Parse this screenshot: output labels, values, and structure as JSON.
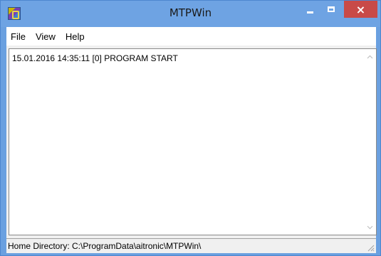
{
  "window": {
    "title": "MTPWin",
    "close_glyph": "×"
  },
  "menu": {
    "items": [
      {
        "label": "File"
      },
      {
        "label": "View"
      },
      {
        "label": "Help"
      }
    ]
  },
  "log": {
    "lines": [
      "15.01.2016 14:35:11 [0] PROGRAM START"
    ]
  },
  "status": {
    "text": "Home Directory: C:\\ProgramData\\aitronic\\MTPWin\\"
  },
  "icons": {
    "app": "app-icon",
    "minimize": "minimize-icon",
    "maximize": "maximize-icon",
    "close": "close-icon",
    "scroll_up": "chevron-up-icon",
    "scroll_down": "chevron-down-icon",
    "grip": "resize-grip-icon"
  },
  "colors": {
    "titlebar": "#6ea3e3",
    "close_button": "#c84a48",
    "client": "#f0f0f0"
  }
}
